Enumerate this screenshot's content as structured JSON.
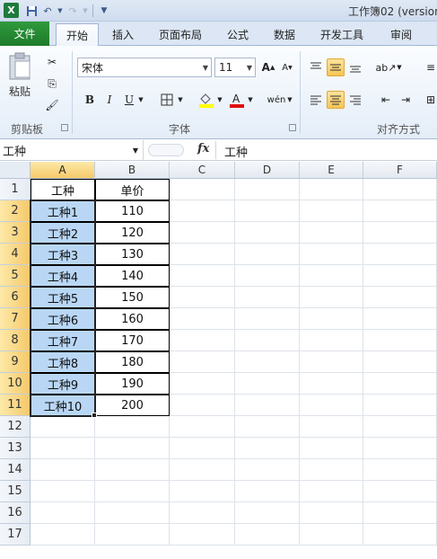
{
  "window": {
    "title": "工作簿02 (version"
  },
  "tabs": [
    {
      "label": "文件"
    },
    {
      "label": "开始"
    },
    {
      "label": "插入"
    },
    {
      "label": "页面布局"
    },
    {
      "label": "公式"
    },
    {
      "label": "数据"
    },
    {
      "label": "开发工具"
    },
    {
      "label": "审阅"
    }
  ],
  "ribbon": {
    "clipboard": {
      "paste_label": "粘贴",
      "group_label": "剪贴板"
    },
    "font": {
      "font_name": "宋体",
      "font_size": "11",
      "group_label": "字体",
      "bold": "B",
      "italic": "I",
      "underline": "U"
    },
    "alignment": {
      "group_label": "对齐方式"
    }
  },
  "formula_bar": {
    "name_box": "工种",
    "fx": "fx",
    "content": "工种"
  },
  "sheet": {
    "columns": [
      "A",
      "B",
      "C",
      "D",
      "E",
      "F"
    ],
    "rows": [
      "1",
      "2",
      "3",
      "4",
      "5",
      "6",
      "7",
      "8",
      "9",
      "10",
      "11",
      "12",
      "13",
      "14",
      "15",
      "16",
      "17"
    ],
    "table": {
      "headers": [
        "工种",
        "单价"
      ],
      "data": [
        [
          "工种1",
          "110"
        ],
        [
          "工种2",
          "120"
        ],
        [
          "工种3",
          "130"
        ],
        [
          "工种4",
          "140"
        ],
        [
          "工种5",
          "150"
        ],
        [
          "工种6",
          "160"
        ],
        [
          "工种7",
          "170"
        ],
        [
          "工种8",
          "180"
        ],
        [
          "工种9",
          "190"
        ],
        [
          "工种10",
          "200"
        ]
      ]
    }
  }
}
